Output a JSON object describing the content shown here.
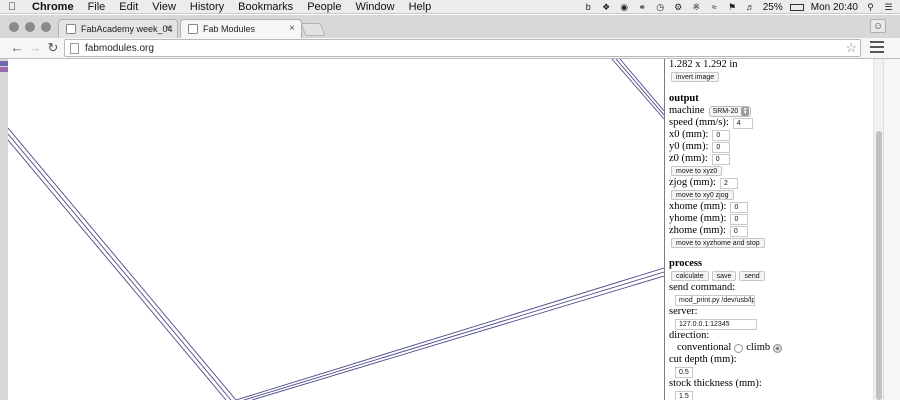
{
  "menubar": {
    "app_name": "Chrome",
    "items": [
      "File",
      "Edit",
      "View",
      "History",
      "Bookmarks",
      "People",
      "Window",
      "Help"
    ],
    "battery": "25%",
    "clock": "Mon 20:40"
  },
  "tabs": [
    {
      "title": "FabAcademy week_04",
      "active": false
    },
    {
      "title": "Fab Modules",
      "active": true
    }
  ],
  "toolbar": {
    "url": "fabmodules.org"
  },
  "panel": {
    "dimensions": "1.282 x 1.292 in",
    "invert_image": "invert image",
    "output": {
      "heading": "output",
      "machine_label": "machine",
      "machine_value": "SRM-20",
      "speed_label": "speed (mm/s):",
      "speed_value": "4",
      "x0_label": "x0 (mm):",
      "x0_value": "0",
      "y0_label": "y0 (mm):",
      "y0_value": "0",
      "z0_label": "z0 (mm):",
      "z0_value": "0",
      "move_xyz0": "move to xyz0",
      "zjog_label": "zjog (mm):",
      "zjog_value": "2",
      "move_xy0_zjog": "move to xy0 zjog",
      "xhome_label": "xhome (mm):",
      "xhome_value": "0",
      "yhome_label": "yhome (mm):",
      "yhome_value": "0",
      "zhome_label": "zhome (mm):",
      "zhome_value": "0",
      "move_home_stop": "move to xyzhome and stop"
    },
    "process": {
      "heading": "process",
      "calculate": "calculate",
      "save": "save",
      "send": "send",
      "send_command_label": "send command:",
      "send_command_value": "mod_print.py /dev/usb/lp",
      "server_label": "server:",
      "server_value": "127.0.0.1:12345",
      "direction_label": "direction:",
      "conventional": "conventional",
      "climb": "climb",
      "direction_selected": "climb",
      "cut_depth_label": "cut depth (mm):",
      "cut_depth_value": "0.5",
      "stock_thickness_label": "stock thickness (mm):",
      "stock_thickness_value": "1.5"
    }
  },
  "colors": {
    "toolpath": "#4a4a8a",
    "menubar_bg": "#ececec",
    "tabstrip_bg": "#d7d7d7"
  }
}
